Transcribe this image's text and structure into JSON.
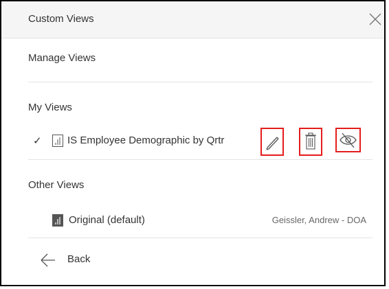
{
  "dialog": {
    "title": "Custom Views",
    "close_icon": "close-icon",
    "manage_views_label": "Manage Views"
  },
  "my_views": {
    "heading": "My Views",
    "items": [
      {
        "checked": true,
        "check_mark": "✓",
        "icon": "sheet-icon",
        "name": "IS Employee Demographic by Qrtr",
        "actions": [
          "edit-pencil-icon",
          "delete-trash-icon",
          "hide-eye-icon"
        ]
      }
    ]
  },
  "other_views": {
    "heading": "Other Views",
    "items": [
      {
        "icon": "sheet-icon-filled",
        "name": "Original (default)",
        "owner": "Geissler, Andrew - DOA"
      }
    ]
  },
  "footer": {
    "back_label": "Back",
    "back_icon": "arrow-left-icon"
  },
  "colors": {
    "highlight": "#e41b1b",
    "header_bg": "#f5f5f5",
    "text": "#333333"
  }
}
